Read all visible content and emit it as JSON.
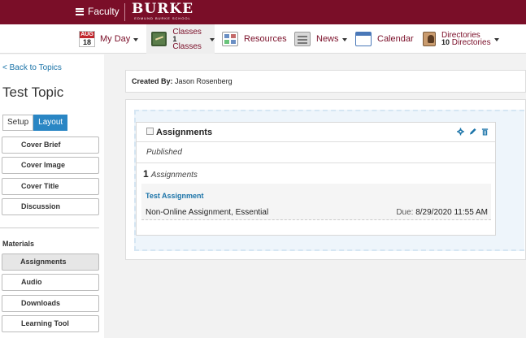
{
  "topbar": {
    "faculty_label": "Faculty",
    "logo_main": "BURKE",
    "logo_sub": "EDMUND BURKE SCHOOL"
  },
  "nav": {
    "myday": {
      "month": "AUG",
      "day": "18",
      "label": "My Day"
    },
    "classes": {
      "label": "Classes",
      "count_num": "1",
      "count_label": "Classes"
    },
    "resources": {
      "label": "Resources"
    },
    "news": {
      "label": "News"
    },
    "calendar": {
      "label": "Calendar"
    },
    "directories": {
      "label": "Directories",
      "count_num": "10",
      "count_label": "Directories"
    }
  },
  "sidebar": {
    "back_link": "< Back to Topics",
    "topic_title": "Test Topic",
    "tabs": [
      "Setup",
      "Layout"
    ],
    "cover_items": [
      "Cover Brief",
      "Cover Image",
      "Cover Title",
      "Discussion"
    ],
    "materials_heading": "Materials",
    "material_items": [
      "Assignments",
      "Audio",
      "Downloads",
      "Learning Tool"
    ]
  },
  "main": {
    "created_by_label": "Created By:",
    "created_by_name": "Jason Rosenberg",
    "card": {
      "title": "Assignments",
      "status": "Published",
      "count": "1",
      "count_label": "Assignments",
      "assignment": {
        "name": "Test Assignment",
        "type": "Non-Online Assignment, Essential",
        "due_label": "Due:",
        "due_value": "8/29/2020 11:55 AM"
      }
    }
  },
  "colors": {
    "brand": "#7a0e28",
    "link": "#1a73a8",
    "active_tab": "#2a86c4"
  }
}
